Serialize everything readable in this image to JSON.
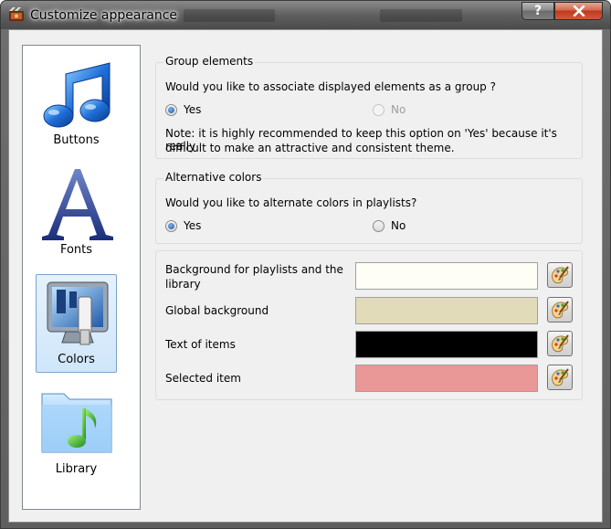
{
  "window": {
    "title": "Customize appearance",
    "help_label": "?",
    "close_label": "x"
  },
  "sidebar": {
    "items": [
      {
        "label": "Buttons",
        "icon": "music-note-icon"
      },
      {
        "label": "Fonts",
        "icon": "letter-a-icon"
      },
      {
        "label": "Colors",
        "icon": "monitor-paint-icon",
        "selected": true
      },
      {
        "label": "Library",
        "icon": "folder-music-icon"
      }
    ]
  },
  "group_elements": {
    "title": "Group elements",
    "question": "Would you like to associate displayed elements as a group ?",
    "yes_label": "Yes",
    "no_label": "No",
    "selected": "Yes",
    "no_disabled": true,
    "note_line1": "Note: it is highly recommended to keep this option on 'Yes' because it's really",
    "note_line2": "difficult to make an attractive and consistent theme."
  },
  "alt_colors": {
    "title": "Alternative colors",
    "question": "Would you like to alternate colors in playlists?",
    "yes_label": "Yes",
    "no_label": "No",
    "selected": "Yes"
  },
  "colors": {
    "rows": [
      {
        "label_line1": "Background for playlists and the",
        "label_line2": "library",
        "color": "#fefdf6"
      },
      {
        "label_line1": "Global background",
        "label_line2": "",
        "color": "#e2dbba"
      },
      {
        "label_line1": "Text of items",
        "label_line2": "",
        "color": "#000000"
      },
      {
        "label_line1": "Selected item",
        "label_line2": "",
        "color": "#e99797"
      }
    ]
  },
  "theme": {
    "accent": "#1f5aa8",
    "selection_bg": "#cfe6fa",
    "selection_border": "#7da2ce"
  }
}
